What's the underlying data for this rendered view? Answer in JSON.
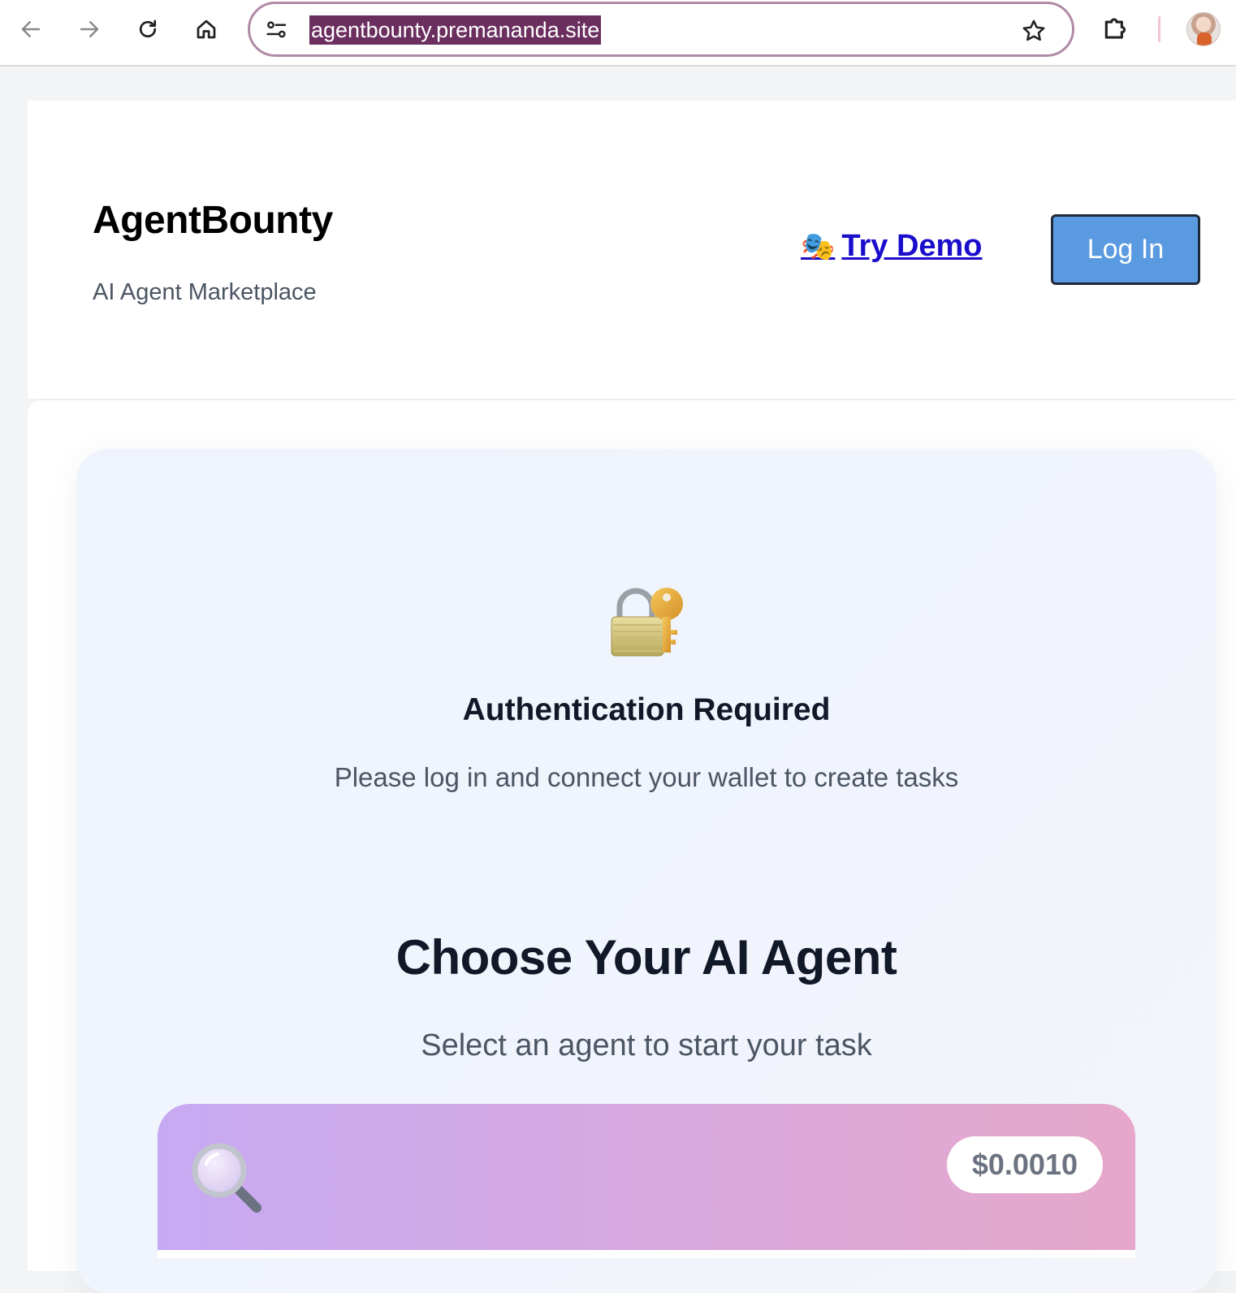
{
  "browser": {
    "url": "agentbounty.premananda.site",
    "icons": [
      "back-arrow-icon",
      "forward-arrow-icon",
      "reload-icon",
      "home-icon",
      "site-settings-icon",
      "bookmark-star-icon",
      "extensions-puzzle-icon",
      "profile-avatar"
    ]
  },
  "header": {
    "brand_title": "AgentBounty",
    "brand_subtitle": "AI Agent Marketplace",
    "demo_icon": "🎭",
    "demo_label": "Try Demo",
    "login_label": "Log In"
  },
  "auth": {
    "icon": "🔐",
    "title": "Authentication Required",
    "message": "Please log in and connect your wallet to create tasks"
  },
  "agents_section": {
    "title": "Choose Your AI Agent",
    "subtitle": "Select an agent to start your task",
    "agents": [
      {
        "icon": "magnifier-icon",
        "price": "$0.0010"
      }
    ]
  },
  "colors": {
    "login_button": "#5a9ae0",
    "demo_link": "#1a0dcc",
    "url_highlight": "#6b2f5f",
    "card_gradient_start": "#c7a9f3",
    "card_gradient_end": "#e6a7ca"
  }
}
